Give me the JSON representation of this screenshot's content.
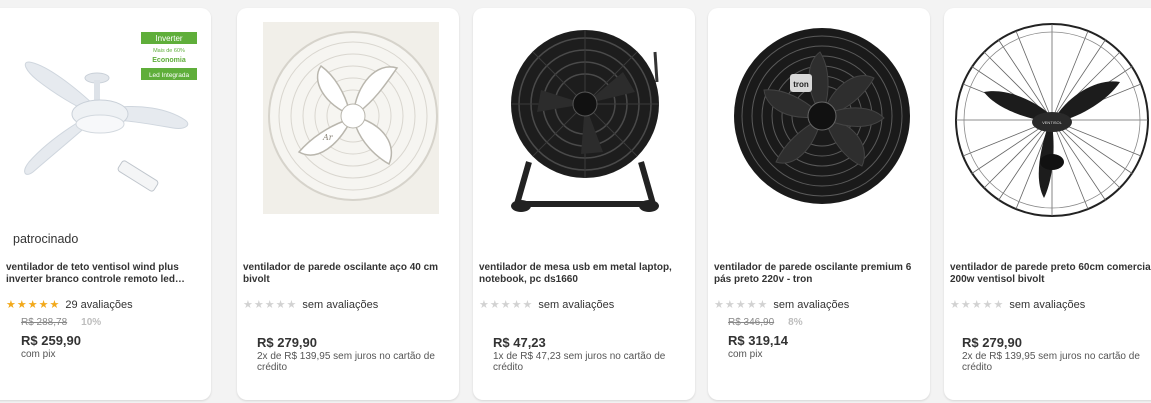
{
  "products": [
    {
      "sponsored": "patrocinado",
      "title": "ventilador de teto ventisol wind plus inverter branco controle remoto led…",
      "rating_stars": 4.5,
      "rating_text": "29 avaliações",
      "old_price": "R$ 288,78",
      "discount": "10%",
      "price": "R$ 259,90",
      "payment": "com pix",
      "image": "ceiling-fan",
      "badge": {
        "line1": "Inverter",
        "line2": "Mais de 60%",
        "line3": "Economia",
        "line4": "Led Integrada"
      }
    },
    {
      "title": "ventilador de parede oscilante aço 40 cm bivolt",
      "rating_stars": 0,
      "rating_text": "sem avaliações",
      "price": "R$ 279,90",
      "payment": "2x de R$ 139,95 sem juros no cartão de crédito",
      "image": "white-wall-fan"
    },
    {
      "title": "ventilador de mesa usb em metal laptop, notebook, pc ds1660",
      "rating_stars": 0,
      "rating_text": "sem avaliações",
      "price": "R$ 47,23",
      "payment": "1x de R$ 47,23 sem juros no cartão de crédito",
      "image": "usb-desk-fan"
    },
    {
      "title": "ventilador de parede oscilante premium 6 pás preto 220v - tron",
      "rating_stars": 0,
      "rating_text": "sem avaliações",
      "old_price": "R$ 346,90",
      "discount": "8%",
      "price": "R$ 319,14",
      "payment": "com pix",
      "image": "black-wall-fan"
    },
    {
      "title": "ventilador de parede preto 60cm comercial 200w ventisol bivolt",
      "rating_stars": 0,
      "rating_text": "sem avaliações",
      "price": "R$ 279,90",
      "payment": "2x de R$ 139,95 sem juros no cartão de crédito",
      "image": "commercial-wall-fan"
    }
  ],
  "colors": {
    "star_full": "#f2a91b",
    "star_empty": "#d2d2d2",
    "badge_green": "#5fae3a"
  }
}
